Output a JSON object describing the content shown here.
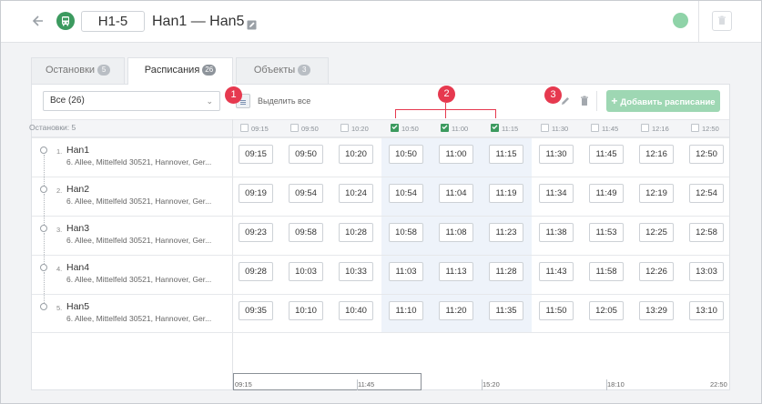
{
  "header": {
    "route_code": "H1-5",
    "route_name": "Han1 — Han5"
  },
  "tabs": [
    {
      "label": "Остановки",
      "count": "5"
    },
    {
      "label": "Расписания",
      "count": "26"
    },
    {
      "label": "Объекты",
      "count": "3"
    }
  ],
  "toolbar": {
    "filter_value": "Все (26)",
    "select_all_label": "Выделить все",
    "add_button_label": "Добавить расписание"
  },
  "stops_header": "Остановки: 5",
  "columns": [
    {
      "time": "09:15",
      "checked": false
    },
    {
      "time": "09:50",
      "checked": false
    },
    {
      "time": "10:20",
      "checked": false
    },
    {
      "time": "10:50",
      "checked": true
    },
    {
      "time": "11:00",
      "checked": true
    },
    {
      "time": "11:15",
      "checked": true
    },
    {
      "time": "11:30",
      "checked": false
    },
    {
      "time": "11:45",
      "checked": false
    },
    {
      "time": "12:16",
      "checked": false
    },
    {
      "time": "12:50",
      "checked": false
    }
  ],
  "stops": [
    {
      "num": "1.",
      "name": "Han1",
      "address": "6. Allee, Mittelfeld 30521, Hannover, Ger...",
      "times": [
        "09:15",
        "09:50",
        "10:20",
        "10:50",
        "11:00",
        "11:15",
        "11:30",
        "11:45",
        "12:16",
        "12:50"
      ]
    },
    {
      "num": "2.",
      "name": "Han2",
      "address": "6. Allee, Mittelfeld 30521, Hannover, Ger...",
      "times": [
        "09:19",
        "09:54",
        "10:24",
        "10:54",
        "11:04",
        "11:19",
        "11:34",
        "11:49",
        "12:19",
        "12:54"
      ]
    },
    {
      "num": "3.",
      "name": "Han3",
      "address": "6. Allee, Mittelfeld 30521, Hannover, Ger...",
      "times": [
        "09:23",
        "09:58",
        "10:28",
        "10:58",
        "11:08",
        "11:23",
        "11:38",
        "11:53",
        "12:25",
        "12:58"
      ]
    },
    {
      "num": "4.",
      "name": "Han4",
      "address": "6. Allee, Mittelfeld 30521, Hannover, Ger...",
      "times": [
        "09:28",
        "10:03",
        "10:33",
        "11:03",
        "11:13",
        "11:28",
        "11:43",
        "11:58",
        "12:26",
        "13:03"
      ]
    },
    {
      "num": "5.",
      "name": "Han5",
      "address": "6. Allee, Mittelfeld 30521, Hannover, Ger...",
      "times": [
        "09:35",
        "10:10",
        "10:40",
        "11:10",
        "11:20",
        "11:35",
        "11:50",
        "12:05",
        "13:29",
        "13:10"
      ]
    }
  ],
  "timeline": {
    "labels": [
      "09:15",
      "11:45",
      "15:20",
      "18:10",
      "22:50"
    ]
  },
  "annotations": [
    "1",
    "2",
    "3"
  ],
  "colors": {
    "accent": "#3c9a5f",
    "annotation": "#e6394f",
    "add_button": "#9ed7b3"
  }
}
